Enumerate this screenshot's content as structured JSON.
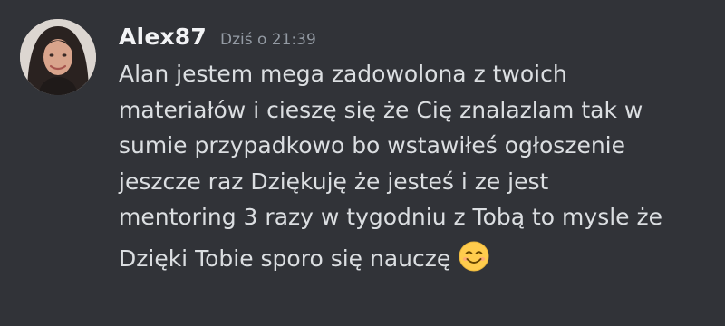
{
  "message": {
    "author": "Alex87",
    "timestamp": "Dziś o 21:39",
    "avatar_icon": "user-avatar-photo",
    "lines": [
      "Alan jestem mega zadowolona z twoich",
      "materiałów i cieszę się że Cię znalazlam tak w",
      "sumie przypadkowo bo wstawiłeś ogłoszenie",
      "jeszcze raz Dziękuję że jesteś i ze jest",
      "mentoring 3 razy w tygodniu z Tobą to mysle że",
      "Dzięki Tobie sporo się nauczę"
    ],
    "emoji": "smiling-face-emoji"
  },
  "colors": {
    "background": "#313338",
    "username": "#f2f3f5",
    "timestamp": "#949ba4",
    "text": "#dbdee1"
  }
}
